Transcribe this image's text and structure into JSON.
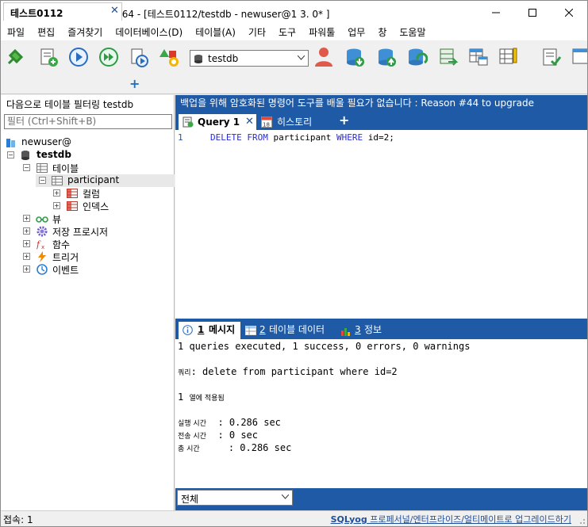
{
  "window": {
    "title": "SQLyog Community 64 - [테스트0112/testdb - newuser@1     3.  0* ]",
    "accent": "#1f5aa6"
  },
  "menubar": {
    "items": [
      "파일",
      "편집",
      "즐겨찾기",
      "데이터베이스(D)",
      "테이블(A)",
      "기타",
      "도구",
      "파워툴",
      "업무",
      "창",
      "도움말"
    ]
  },
  "toolbar": {
    "database": "testdb"
  },
  "connection_tab": {
    "label": "테스트0112"
  },
  "object_browser": {
    "filter_label": "다음으로 테이블 필터링 testdb",
    "filter_placeholder": "필터 (Ctrl+Shift+B)",
    "server": "newuser@",
    "database": "testdb",
    "tables_folder": "테이블",
    "table": "participant",
    "columns_folder": "컬럼",
    "indexes_folder": "인덱스",
    "folders": [
      "뷰",
      "저장 프로시저",
      "함수",
      "트리거",
      "이벤트"
    ]
  },
  "banner": {
    "text": "백업을 위해 암호화된 명령어 도구를 배울 필요가 없습니다 : Reason #44 to upgrade"
  },
  "query_tabs": {
    "query": "Query 1",
    "history": "히스토리"
  },
  "editor": {
    "line_number": "1",
    "kw_delete": "DELETE",
    "kw_from": "FROM",
    "table": "participant",
    "kw_where": "WHERE",
    "condition": "id=2;"
  },
  "result_tabs": {
    "messages_num": "1",
    "messages": "메시지",
    "table_data_num": "2",
    "table_data": "테이블 데이터",
    "info_num": "3",
    "info": "정보"
  },
  "messages": {
    "summary": "1 queries executed, 1 success, 0 errors, 0 warnings",
    "query_label": "쿼리",
    "query_text": ": delete from participant where id=2",
    "rows_num": "1",
    "rows_label": "열에 적용됨",
    "exec_label": "실행 시간",
    "exec_value": ": 0.286 sec",
    "transfer_label": "전송 시간",
    "transfer_value": ": 0 sec",
    "total_label": "총 시간",
    "total_value": ": 0.286 sec"
  },
  "result_footer": {
    "scope": "전체"
  },
  "statusbar": {
    "connections": "접속: 1",
    "upgrade_brand": "SQLyog",
    "upgrade_text": " 프로페서널/엔터프라이즈/얼티메이트로 업그레이드하기"
  }
}
